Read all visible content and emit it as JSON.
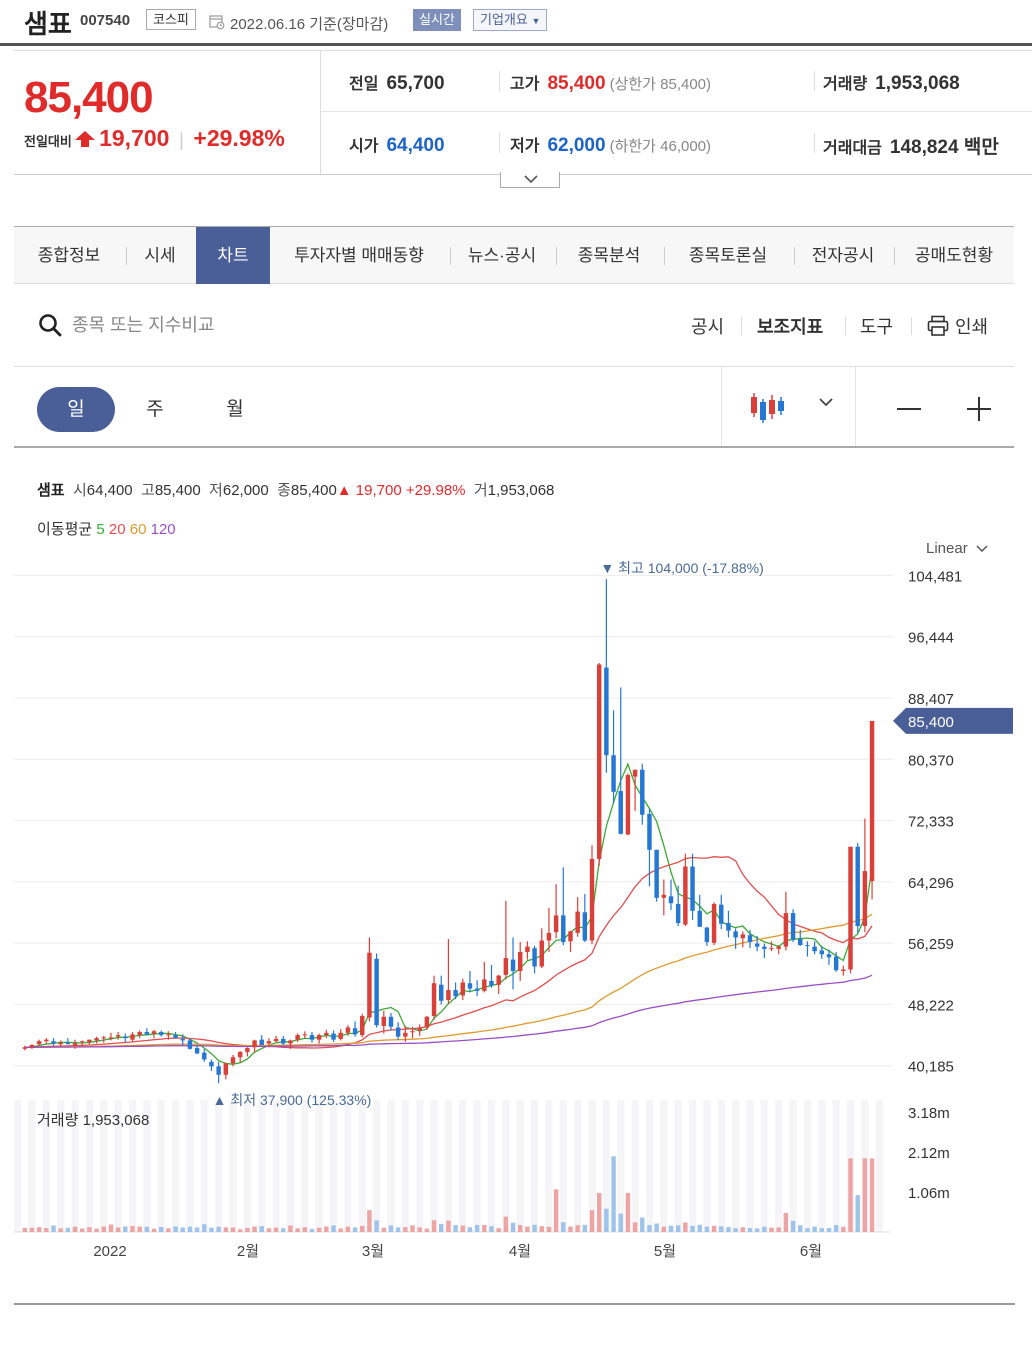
{
  "header": {
    "name": "샘표",
    "code": "007540",
    "market": "코스피",
    "date": "2022.06.16",
    "basis": "기준(장마감)",
    "realtime_label": "실시간",
    "company_label": "기업개요"
  },
  "price": {
    "current": "85,400",
    "change_label": "전일대비",
    "change_value": "19,700",
    "change_pct": "+29.98%",
    "prev_label": "전일",
    "prev_value": "65,700",
    "high_label": "고가",
    "high_value": "85,400",
    "high_sub": "(상한가 85,400)",
    "volume_label": "거래량",
    "volume_value": "1,953,068",
    "open_label": "시가",
    "open_value": "64,400",
    "low_label": "저가",
    "low_value": "62,000",
    "low_sub": "(하한가 46,000)",
    "amount_label": "거래대금",
    "amount_value": "148,824 백만"
  },
  "tabs": [
    "종합정보",
    "시세",
    "차트",
    "투자자별 매매동향",
    "뉴스·공시",
    "종목분석",
    "종목토론실",
    "전자공시",
    "공매도현황"
  ],
  "active_tab": "차트",
  "toolbar": {
    "search_placeholder": "종목 또는 지수비교",
    "disclosure": "공시",
    "indicator": "보조지표",
    "tools": "도구",
    "print": "인쇄"
  },
  "periods": [
    "일",
    "주",
    "월"
  ],
  "active_period": "일",
  "chart_info": {
    "name": "샘표",
    "open_label": "시",
    "open": "64,400",
    "high_label": "고",
    "high": "85,400",
    "low_label": "저",
    "low": "62,000",
    "close_label": "종",
    "close": "85,400",
    "change": "▲ 19,700",
    "pct": "+29.98%",
    "vol_label": "거",
    "vol": "1,953,068",
    "ma_label": "이동평균",
    "ma": [
      "5",
      "20",
      "60",
      "120"
    ],
    "ma_colors": [
      "#3aaa35",
      "#e04e4e",
      "#e09a30",
      "#9b4fc5"
    ],
    "scale": "Linear"
  },
  "chart_data": {
    "type": "candlestick",
    "ylim": [
      37000,
      106500
    ],
    "y_ticks": [
      "104,481",
      "96,444",
      "88,407",
      "80,370",
      "72,333",
      "64,296",
      "56,259",
      "48,222",
      "40,185"
    ],
    "y_tick_values": [
      104481,
      96444,
      88407,
      80370,
      72333,
      64296,
      56259,
      48222,
      40185
    ],
    "current_label": "85,400",
    "current_value": 85400,
    "max_label": "▼ 최고 104,000 (-17.88%)",
    "min_label": "▲ 최저 37,900 (125.33%)",
    "x_labels": [
      "2022",
      "2월",
      "3월",
      "4월",
      "5월",
      "6월"
    ],
    "volume_title": "거래량 1,953,068",
    "volume_ticks": [
      "3.18m",
      "2.12m",
      "1.06m"
    ],
    "volume_tick_values": [
      3180000,
      2120000,
      1060000
    ],
    "colors": {
      "up": "#d9403a",
      "down": "#2677d3"
    },
    "candles": [
      [
        42400,
        42800,
        42200,
        42600,
        107000
      ],
      [
        42600,
        43000,
        42400,
        42900,
        113000
      ],
      [
        43000,
        43600,
        42800,
        43400,
        129000
      ],
      [
        43400,
        43800,
        43100,
        43600,
        103000
      ],
      [
        43400,
        43800,
        42800,
        43100,
        174000
      ],
      [
        43000,
        43500,
        42700,
        43200,
        94000
      ],
      [
        43200,
        43800,
        43000,
        43000,
        111000
      ],
      [
        42900,
        43600,
        42400,
        43100,
        141000
      ],
      [
        43300,
        43500,
        42800,
        43400,
        93000
      ],
      [
        43300,
        43600,
        43000,
        43600,
        128000
      ],
      [
        43500,
        44000,
        43100,
        43800,
        87000
      ],
      [
        43800,
        44100,
        43200,
        43900,
        144000
      ],
      [
        43800,
        44500,
        43500,
        43900,
        200000
      ],
      [
        44000,
        44600,
        43600,
        44200,
        120000
      ],
      [
        44000,
        44400,
        43300,
        43800,
        147000
      ],
      [
        43600,
        44600,
        43400,
        44300,
        158000
      ],
      [
        44200,
        44800,
        43800,
        44600,
        142000
      ],
      [
        44600,
        45100,
        44200,
        44300,
        141000
      ],
      [
        44400,
        44900,
        43800,
        44700,
        86000
      ],
      [
        44600,
        44800,
        44000,
        44200,
        133000
      ],
      [
        44300,
        44700,
        43600,
        44300,
        97000
      ],
      [
        44200,
        44600,
        43800,
        43800,
        148000
      ],
      [
        43700,
        44300,
        42900,
        43500,
        120000
      ],
      [
        43500,
        43800,
        42300,
        42400,
        143000
      ],
      [
        42500,
        42900,
        41700,
        41800,
        121000
      ],
      [
        41900,
        42400,
        40700,
        41000,
        207000
      ],
      [
        40700,
        41000,
        39500,
        40100,
        116000
      ],
      [
        40100,
        40700,
        37900,
        39000,
        138000
      ],
      [
        39000,
        40600,
        38400,
        40500,
        124000
      ],
      [
        40500,
        41600,
        40100,
        41300,
        119000
      ],
      [
        41300,
        42100,
        40600,
        42000,
        71000
      ],
      [
        42000,
        42600,
        41400,
        42500,
        107000
      ],
      [
        42600,
        43600,
        41900,
        43500,
        146000
      ],
      [
        43600,
        44200,
        42900,
        42900,
        154000
      ],
      [
        43100,
        43800,
        42600,
        43400,
        99000
      ],
      [
        43400,
        44100,
        43200,
        43700,
        118000
      ],
      [
        43700,
        44100,
        42900,
        43100,
        101000
      ],
      [
        43100,
        43600,
        42400,
        43500,
        174000
      ],
      [
        43600,
        44400,
        43300,
        44200,
        98000
      ],
      [
        44200,
        44700,
        43800,
        44300,
        129000
      ],
      [
        44200,
        44600,
        43200,
        43600,
        81000
      ],
      [
        43600,
        44400,
        43100,
        44200,
        111000
      ],
      [
        44200,
        44900,
        43800,
        44500,
        147000
      ],
      [
        44400,
        44800,
        43300,
        43600,
        175000
      ],
      [
        43700,
        45000,
        43500,
        44500,
        94000
      ],
      [
        44500,
        45500,
        44100,
        45200,
        142000
      ],
      [
        45100,
        46000,
        44000,
        44300,
        121000
      ],
      [
        44200,
        47000,
        43900,
        46700,
        162000
      ],
      [
        46500,
        57000,
        46000,
        55000,
        580000
      ],
      [
        54200,
        54900,
        45200,
        45500,
        306000
      ],
      [
        45400,
        47400,
        44400,
        46600,
        113000
      ],
      [
        46600,
        47100,
        44800,
        45300,
        173000
      ],
      [
        45200,
        45900,
        43600,
        44000,
        122000
      ],
      [
        44000,
        45400,
        43300,
        44500,
        129000
      ],
      [
        44600,
        45300,
        43800,
        44700,
        179000
      ],
      [
        44800,
        45600,
        44100,
        45200,
        125000
      ],
      [
        45200,
        46700,
        44900,
        46600,
        93000
      ],
      [
        46700,
        52000,
        46200,
        51000,
        313000
      ],
      [
        50800,
        52000,
        48200,
        48700,
        213000
      ],
      [
        48800,
        56800,
        48300,
        50100,
        304000
      ],
      [
        50100,
        51100,
        48900,
        49300,
        184000
      ],
      [
        49400,
        51600,
        48800,
        51100,
        170000
      ],
      [
        51000,
        52600,
        49800,
        50300,
        127000
      ],
      [
        50300,
        51400,
        49300,
        50000,
        188000
      ],
      [
        50000,
        53800,
        49800,
        51500,
        186000
      ],
      [
        51300,
        53400,
        50400,
        50700,
        154000
      ],
      [
        50800,
        52100,
        49600,
        52000,
        101000
      ],
      [
        52100,
        61800,
        51500,
        54300,
        407000
      ],
      [
        54100,
        57000,
        50200,
        52600,
        245000
      ],
      [
        52600,
        56400,
        51300,
        55100,
        184000
      ],
      [
        55100,
        56500,
        54100,
        55800,
        144000
      ],
      [
        55600,
        55900,
        52300,
        53200,
        191000
      ],
      [
        53200,
        58200,
        53000,
        56600,
        154000
      ],
      [
        56600,
        60900,
        55100,
        57600,
        136000
      ],
      [
        57700,
        64000,
        56900,
        59900,
        1131000
      ],
      [
        59900,
        66200,
        56000,
        56400,
        258000
      ],
      [
        56500,
        57900,
        55100,
        57800,
        144000
      ],
      [
        57600,
        62300,
        57100,
        60400,
        180000
      ],
      [
        60300,
        62700,
        56400,
        56600,
        189000
      ],
      [
        56600,
        69100,
        56100,
        67300,
        578000
      ],
      [
        67300,
        93000,
        66400,
        92800,
        1036000
      ],
      [
        92400,
        104000,
        78600,
        80900,
        616000
      ],
      [
        80900,
        86800,
        74600,
        76100,
        2008000
      ],
      [
        76200,
        89800,
        70500,
        70600,
        487000
      ],
      [
        70500,
        78500,
        70400,
        78300,
        1036000
      ],
      [
        78100,
        79000,
        73600,
        79000,
        258000
      ],
      [
        79000,
        79800,
        71800,
        73100,
        383000
      ],
      [
        73200,
        73900,
        63700,
        68500,
        183000
      ],
      [
        68500,
        68500,
        61700,
        62200,
        224000
      ],
      [
        62200,
        64600,
        59900,
        62600,
        142000
      ],
      [
        62400,
        64600,
        60600,
        61500,
        167000
      ],
      [
        61400,
        63800,
        58500,
        58900,
        177000
      ],
      [
        58700,
        68000,
        58500,
        66300,
        251000
      ],
      [
        66300,
        68000,
        59300,
        60500,
        163000
      ],
      [
        60500,
        62600,
        58400,
        58400,
        191000
      ],
      [
        58300,
        58400,
        55900,
        56400,
        143000
      ],
      [
        56300,
        61600,
        56000,
        61400,
        165000
      ],
      [
        61300,
        62600,
        58100,
        58800,
        151000
      ],
      [
        58900,
        60500,
        57000,
        57900,
        129000
      ],
      [
        57800,
        58200,
        55500,
        57000,
        101000
      ],
      [
        56900,
        57800,
        55700,
        57400,
        127000
      ],
      [
        57300,
        58000,
        55600,
        56400,
        103000
      ],
      [
        56200,
        57200,
        55200,
        55800,
        94000
      ],
      [
        55800,
        56200,
        54300,
        55500,
        138000
      ],
      [
        55600,
        56500,
        55200,
        55600,
        113000
      ],
      [
        55500,
        56000,
        54800,
        55800,
        119000
      ],
      [
        55800,
        63000,
        55300,
        60200,
        505000
      ],
      [
        60200,
        60700,
        56400,
        56700,
        296000
      ],
      [
        56800,
        58000,
        55900,
        56000,
        180000
      ],
      [
        56000,
        56500,
        54500,
        55900,
        102000
      ],
      [
        55800,
        56500,
        54800,
        55200,
        144000
      ],
      [
        55300,
        55900,
        54200,
        54800,
        102000
      ],
      [
        54800,
        55400,
        53400,
        54400,
        105000
      ],
      [
        54500,
        55100,
        52500,
        52700,
        186000
      ],
      [
        52600,
        53300,
        52000,
        52800,
        138000
      ],
      [
        52800,
        68900,
        52300,
        68900,
        1953000
      ],
      [
        68900,
        69400,
        57600,
        58500,
        978000
      ],
      [
        58500,
        72600,
        57700,
        65700,
        1953000
      ],
      [
        64400,
        85400,
        62000,
        85400,
        1953068
      ]
    ]
  }
}
